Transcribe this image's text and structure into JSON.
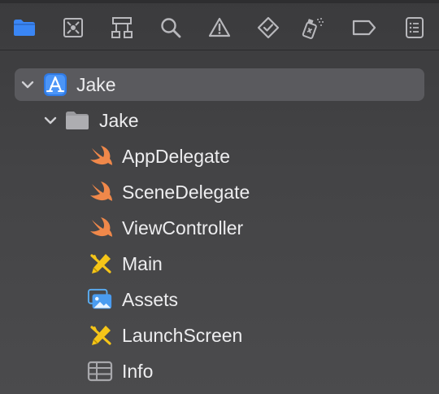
{
  "toolbar": {
    "buttons": [
      {
        "name": "project-navigator",
        "icon": "folder-icon",
        "active": true
      },
      {
        "name": "source-control-navigator",
        "icon": "source-control-icon",
        "active": false
      },
      {
        "name": "symbol-navigator",
        "icon": "symbol-hierarchy-icon",
        "active": false
      },
      {
        "name": "find-navigator",
        "icon": "magnifier-icon",
        "active": false
      },
      {
        "name": "issue-navigator",
        "icon": "warning-triangle-icon",
        "active": false
      },
      {
        "name": "test-navigator",
        "icon": "test-diamond-icon",
        "active": false
      },
      {
        "name": "debug-navigator",
        "icon": "spray-can-icon",
        "active": false
      },
      {
        "name": "breakpoint-navigator",
        "icon": "breakpoint-tag-icon",
        "active": false
      },
      {
        "name": "report-navigator",
        "icon": "report-list-icon",
        "active": false
      }
    ],
    "accent_color": "#3a86f5"
  },
  "tree": {
    "project": {
      "label": "Jake",
      "icon": "xcode-project-icon",
      "expanded": true,
      "selected": true
    },
    "group": {
      "label": "Jake",
      "icon": "folder-icon",
      "expanded": true
    },
    "files": [
      {
        "label": "AppDelegate",
        "icon": "swift-file-icon"
      },
      {
        "label": "SceneDelegate",
        "icon": "swift-file-icon"
      },
      {
        "label": "ViewController",
        "icon": "swift-file-icon"
      },
      {
        "label": "Main",
        "icon": "storyboard-icon"
      },
      {
        "label": "Assets",
        "icon": "asset-catalog-icon"
      },
      {
        "label": "LaunchScreen",
        "icon": "storyboard-icon"
      },
      {
        "label": "Info",
        "icon": "plist-table-icon"
      }
    ]
  }
}
